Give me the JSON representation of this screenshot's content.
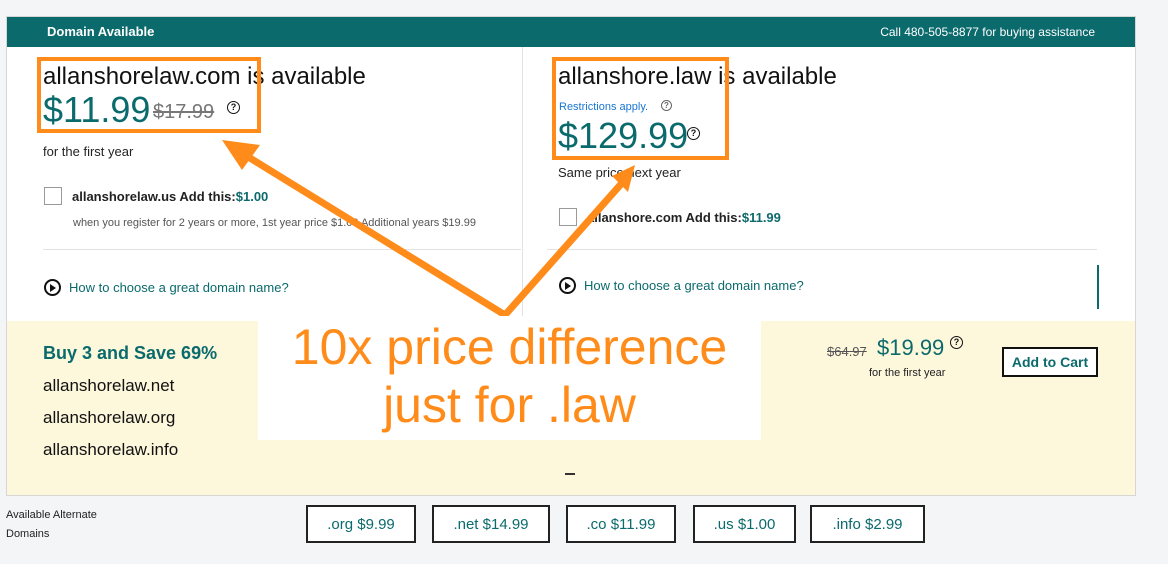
{
  "header": {
    "title": "Domain Available",
    "phone": "Call 480-505-8877 for buying assistance"
  },
  "left": {
    "domain": "allanshorelaw.com",
    "available_text": "is available",
    "price": "$11.99",
    "old_price": "$17.99",
    "price_note": "for the first year",
    "addon_domain": "allanshorelaw.us",
    "addon_label": "Add this:",
    "addon_price": "$1.00",
    "addon_note": "when you register for 2 years or more, 1st year price $1.00 Additional years $19.99",
    "howto": "How to choose a great domain name?"
  },
  "right": {
    "domain": "allanshore.law",
    "available_text": "is available",
    "restrictions": "Restrictions apply.",
    "price": "$129.99",
    "price_note": "Same price next year",
    "addon_domain": "allanshore.com",
    "addon_label": "Add this:",
    "addon_price": "$11.99",
    "howto": "How to choose a great domain name?"
  },
  "bundle": {
    "title": "Buy 3 and Save 69%",
    "items": [
      "allanshorelaw.net",
      "allanshorelaw.org",
      "allanshorelaw.info"
    ],
    "old_price": "$64.97",
    "price": "$19.99",
    "price_note": "for the first year",
    "cart_label": "Add to Cart"
  },
  "alternates": {
    "label": "Available Alternate Domains",
    "options": [
      ".org $9.99",
      ".net $14.99",
      ".co $11.99",
      ".us $1.00",
      ".info $2.99"
    ]
  },
  "annotation": {
    "line1": "10x price difference",
    "line2": "just for .law",
    "color": "#ff8c1a"
  },
  "colors": {
    "brand": "#0b6a6c",
    "link": "#1976d2",
    "bundle_bg": "#fdf7dc"
  },
  "help_glyph": "?"
}
